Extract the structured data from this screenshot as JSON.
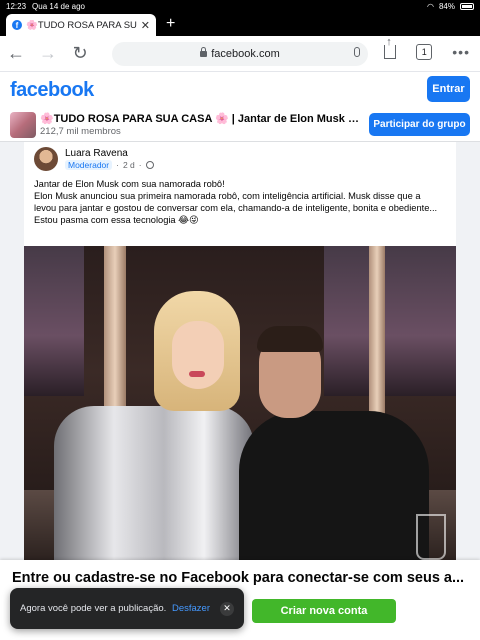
{
  "status_bar": {
    "time": "12:23",
    "date": "Qua 14 de ago",
    "battery": "84%"
  },
  "browser": {
    "tab_title": "🌸TUDO ROSA PARA SUA",
    "url": "facebook.com",
    "tabs_count": "1"
  },
  "header": {
    "logo": "facebook",
    "login_button": "Entrar"
  },
  "group": {
    "title": "🌸TUDO ROSA PARA SUA CASA 🌸 | Jantar de Elon Musk com...",
    "members": "212,7 mil membros",
    "join_button": "Participar do grupo"
  },
  "post": {
    "author": "Luara Ravena",
    "badge": "Moderador",
    "time": "2 d",
    "text_lines": [
      "Jantar de Elon Musk com sua namorada robô!",
      "Elon Musk anunciou sua primeira namorada robô, com inteligência artificial. Musk disse que a levou para jantar e gostou de conversar com ela, chamando-a de inteligente, bonita e obediente...",
      "Estou pasma com essa tecnologia 😂😜"
    ]
  },
  "login_banner": {
    "title": "Entre ou cadastre-se no Facebook para conectar-se com seus a...",
    "create_button": "Criar nova conta"
  },
  "toast": {
    "message": "Agora você pode ver a publicação.",
    "undo": "Desfazer"
  },
  "colors": {
    "facebook_blue": "#1877f2",
    "create_green": "#42b72a"
  }
}
